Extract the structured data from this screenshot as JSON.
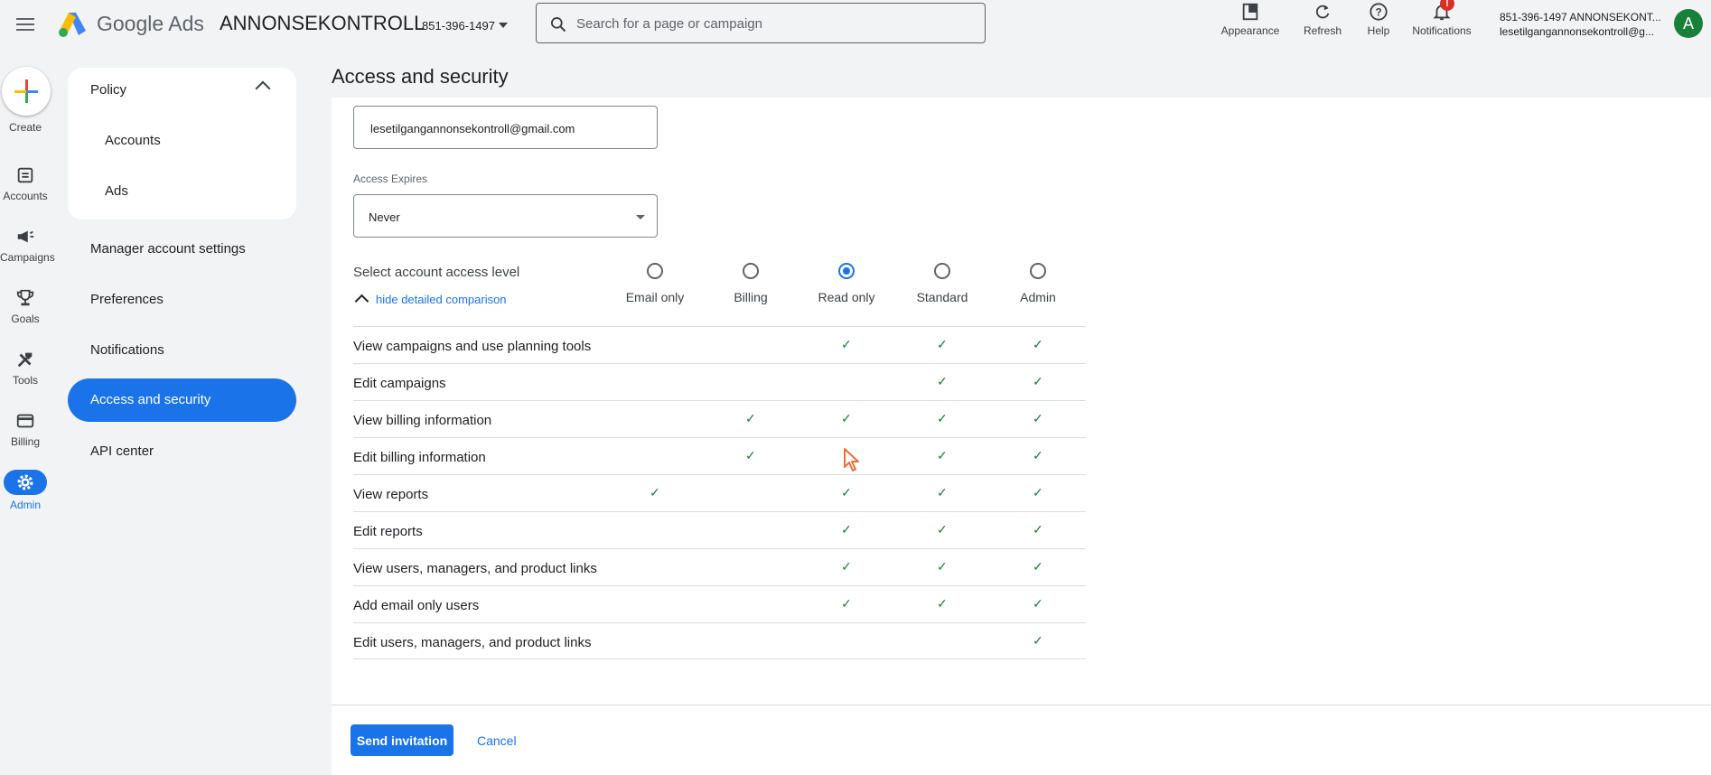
{
  "topbar": {
    "brand": "Google Ads",
    "account_name": "ANNONSEKONTROLL",
    "account_id": "851-396-1497",
    "search_placeholder": "Search for a page or campaign",
    "actions": [
      {
        "label": "Appearance",
        "icon": "appearance-icon"
      },
      {
        "label": "Refresh",
        "icon": "refresh-icon"
      },
      {
        "label": "Help",
        "icon": "help-icon"
      },
      {
        "label": "Notifications",
        "icon": "bell-icon",
        "badge": "!"
      }
    ],
    "user": {
      "name": "851-396-1497 ANNONSEKONT...",
      "email": "lesetilgangannonsekontroll@g...",
      "avatar_letter": "A"
    }
  },
  "rail": [
    {
      "label": "Create",
      "icon": "plus-icon"
    },
    {
      "label": "Accounts",
      "icon": "accounts-icon"
    },
    {
      "label": "Campaigns",
      "icon": "megaphone-icon"
    },
    {
      "label": "Goals",
      "icon": "trophy-icon"
    },
    {
      "label": "Tools",
      "icon": "tools-icon"
    },
    {
      "label": "Billing",
      "icon": "card-icon"
    },
    {
      "label": "Admin",
      "icon": "gear-icon",
      "active": true
    }
  ],
  "subnav": {
    "policy": "Policy",
    "policy_children": [
      "Accounts",
      "Ads"
    ],
    "items": [
      "Manager account settings",
      "Preferences",
      "Notifications",
      "Access and security",
      "API center"
    ],
    "active": "Access and security"
  },
  "page": {
    "title": "Access and security",
    "email_value": "lesetilgangannonsekontroll@gmail.com",
    "expires_label": "Access Expires",
    "expires_value": "Never",
    "access_label": "Select account access level",
    "hide_link": "hide detailed comparison",
    "levels": [
      "Email only",
      "Billing",
      "Read only",
      "Standard",
      "Admin"
    ],
    "selected_level": "Read only",
    "permissions": [
      {
        "label": "View campaigns and use planning tools",
        "checks": [
          false,
          false,
          true,
          true,
          true
        ]
      },
      {
        "label": "Edit campaigns",
        "checks": [
          false,
          false,
          false,
          true,
          true
        ]
      },
      {
        "label": "View billing information",
        "checks": [
          false,
          true,
          true,
          true,
          true
        ]
      },
      {
        "label": "Edit billing information",
        "checks": [
          false,
          true,
          false,
          true,
          true
        ]
      },
      {
        "label": "View reports",
        "checks": [
          true,
          false,
          true,
          true,
          true
        ]
      },
      {
        "label": "Edit reports",
        "checks": [
          false,
          false,
          true,
          true,
          true
        ]
      },
      {
        "label": "View users, managers, and product links",
        "checks": [
          false,
          false,
          true,
          true,
          true
        ]
      },
      {
        "label": "Add email only users",
        "checks": [
          false,
          false,
          true,
          true,
          true
        ]
      },
      {
        "label": "Edit users, managers, and product links",
        "checks": [
          false,
          false,
          false,
          false,
          true
        ]
      }
    ],
    "check_glyph": "✓",
    "send_label": "Send invitation",
    "cancel_label": "Cancel"
  },
  "colors": {
    "accent": "#1a73e8",
    "check": "#188038",
    "badge": "#d93025"
  }
}
